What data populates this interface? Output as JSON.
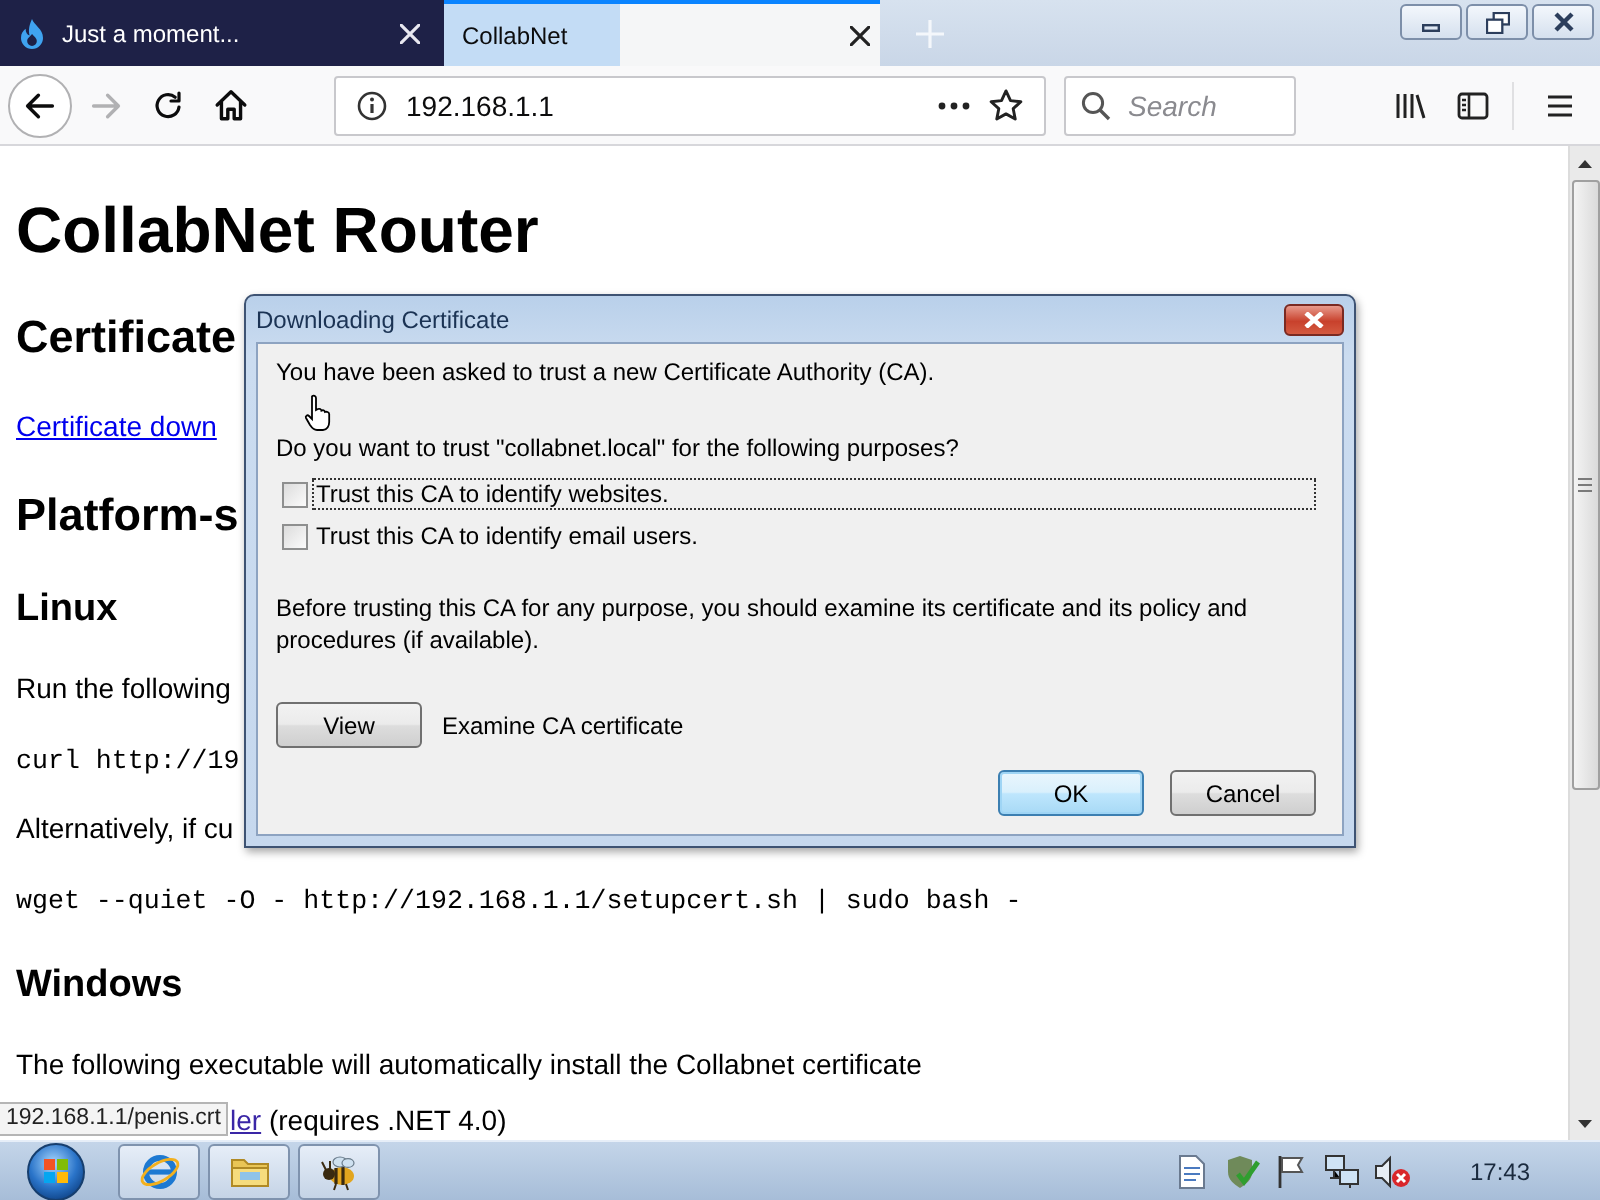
{
  "browser": {
    "tabs": [
      {
        "title": "Just a moment...",
        "selected": false,
        "favicon": true
      },
      {
        "title": "CollabNet",
        "selected": true,
        "favicon": false
      }
    ],
    "toolbar": {
      "forward_disabled": true,
      "url": "192.168.1.1",
      "search": {
        "placeholder": "Search"
      }
    }
  },
  "page": {
    "blocks": [
      {
        "kind": "h1",
        "text": "CollabNet Router"
      },
      {
        "kind": "h2",
        "text": "Certificate"
      },
      {
        "kind": "link",
        "text": "Certificate down"
      },
      {
        "kind": "h2",
        "text": "Platform-s"
      },
      {
        "kind": "h3",
        "text": "Linux"
      },
      {
        "kind": "p",
        "text": "Run the following"
      },
      {
        "kind": "code",
        "text": "curl http://19"
      },
      {
        "kind": "p",
        "text": "Alternatively, if cu"
      },
      {
        "kind": "code",
        "text": "wget --quiet -O - http://192.168.1.1/setupcert.sh | sudo bash -"
      },
      {
        "kind": "h3",
        "text": "Windows"
      },
      {
        "kind": "p",
        "text": "The following executable will automatically install the Collabnet certificate"
      },
      {
        "kind": "p_link",
        "link": "ler",
        "text": " (requires .NET 4.0)"
      }
    ]
  },
  "status_url": "192.168.1.1/penis.crt",
  "dialog": {
    "title": "Downloading Certificate",
    "message": "You have been asked to trust a new Certificate Authority (CA).",
    "question": "Do you want to trust \"collabnet.local\" for the following purposes?",
    "options": [
      {
        "label": "Trust this CA to identify websites.",
        "checked": false,
        "focused": true
      },
      {
        "label": "Trust this CA to identify email users.",
        "checked": false,
        "focused": false
      }
    ],
    "note": "Before trusting this CA for any purpose, you should examine its certificate and its policy and procedures (if available).",
    "view_button": "View",
    "view_description": "Examine CA certificate",
    "buttons": [
      {
        "label": "OK",
        "default": true
      },
      {
        "label": "Cancel",
        "default": false
      }
    ]
  },
  "taskbar": {
    "clock": "17:43"
  }
}
